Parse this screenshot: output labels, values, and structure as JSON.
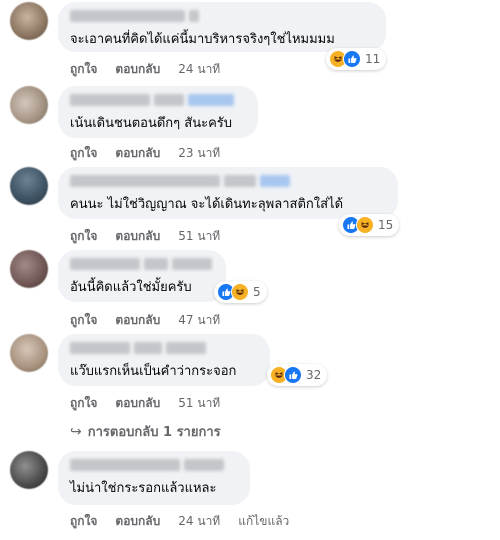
{
  "comments": [
    {
      "text": "จะเอาคนที่คิดได้แค่นี้มาบริหารจริงๆใช่ไหมมมม",
      "reaction_count": "11",
      "reactions": [
        "haha-icon",
        "like-icon"
      ],
      "actions": {
        "like": "ถูกใจ",
        "reply": "ตอบกลับ",
        "time": "24 นาที"
      }
    },
    {
      "text": "เน้นเดินชนตอนดึกๆ สันะครับ",
      "actions": {
        "like": "ถูกใจ",
        "reply": "ตอบกลับ",
        "time": "23 นาที"
      }
    },
    {
      "text": "คนนะ ไม่ใช่วิญญาณ จะได้เดินทะลุพลาสติกใส่ได้",
      "reaction_count": "15",
      "reactions": [
        "like-icon",
        "haha-icon"
      ],
      "actions": {
        "like": "ถูกใจ",
        "reply": "ตอบกลับ",
        "time": "51 นาที"
      }
    },
    {
      "text": "อันนี้คิดแล้วใช่มั้ยครับ",
      "reaction_count": "5",
      "reactions": [
        "like-icon",
        "haha-icon"
      ],
      "actions": {
        "like": "ถูกใจ",
        "reply": "ตอบกลับ",
        "time": "47 นาที"
      }
    },
    {
      "text": "แว๊บแรกเห็นเป็นคำว่ากระจอก",
      "reaction_count": "32",
      "reactions": [
        "haha-icon",
        "like-icon"
      ],
      "actions": {
        "like": "ถูกใจ",
        "reply": "ตอบกลับ",
        "time": "51 นาที"
      },
      "replies_label": "การตอบกลับ 1 รายการ"
    },
    {
      "text": "ไม่น่าใช่กระรอกแล้วแหละ",
      "actions": {
        "like": "ถูกใจ",
        "reply": "ตอบกลับ",
        "time": "24 นาที",
        "edited": "แก้ไขแล้ว"
      }
    }
  ],
  "colors": {
    "bubble": "#f0f2f5",
    "meta": "#65676b",
    "like_blue": "#1877f2",
    "haha_yellow": "#f7b125"
  }
}
